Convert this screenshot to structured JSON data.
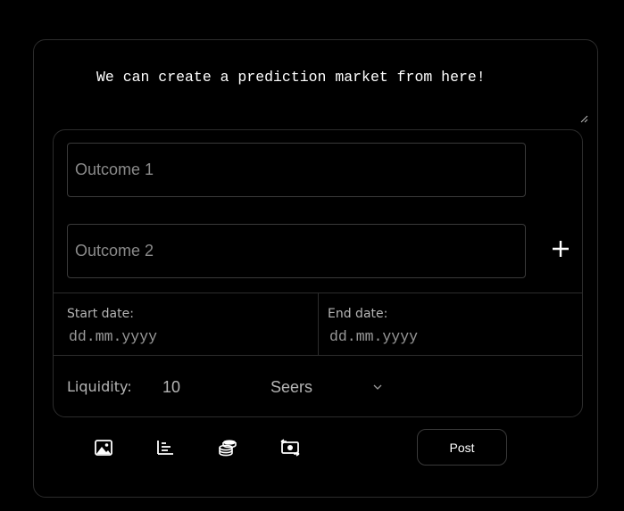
{
  "composer": {
    "text": "We can create a prediction market from here!"
  },
  "poll": {
    "outcomes": [
      {
        "placeholder": "Outcome 1",
        "value": ""
      },
      {
        "placeholder": "Outcome 2",
        "value": ""
      }
    ],
    "add_icon": "plus-icon",
    "start_date": {
      "label": "Start date:",
      "placeholder": "dd.mm.yyyy"
    },
    "end_date": {
      "label": "End date:",
      "placeholder": "dd.mm.yyyy"
    },
    "liquidity": {
      "label": "Liquidity:",
      "value": "10"
    },
    "token": {
      "selected": "Seers",
      "icon": "chevron-down-icon"
    }
  },
  "toolbar": {
    "icons": [
      "image-icon",
      "poll-chart-icon",
      "coin-stack-icon",
      "money-exchange-icon"
    ],
    "post_label": "Post"
  },
  "colors": {
    "background": "#000000",
    "border": "#2c2c2c",
    "text": "#ffffff",
    "muted_text": "#b5b5b5",
    "placeholder": "#8a8a8a"
  }
}
